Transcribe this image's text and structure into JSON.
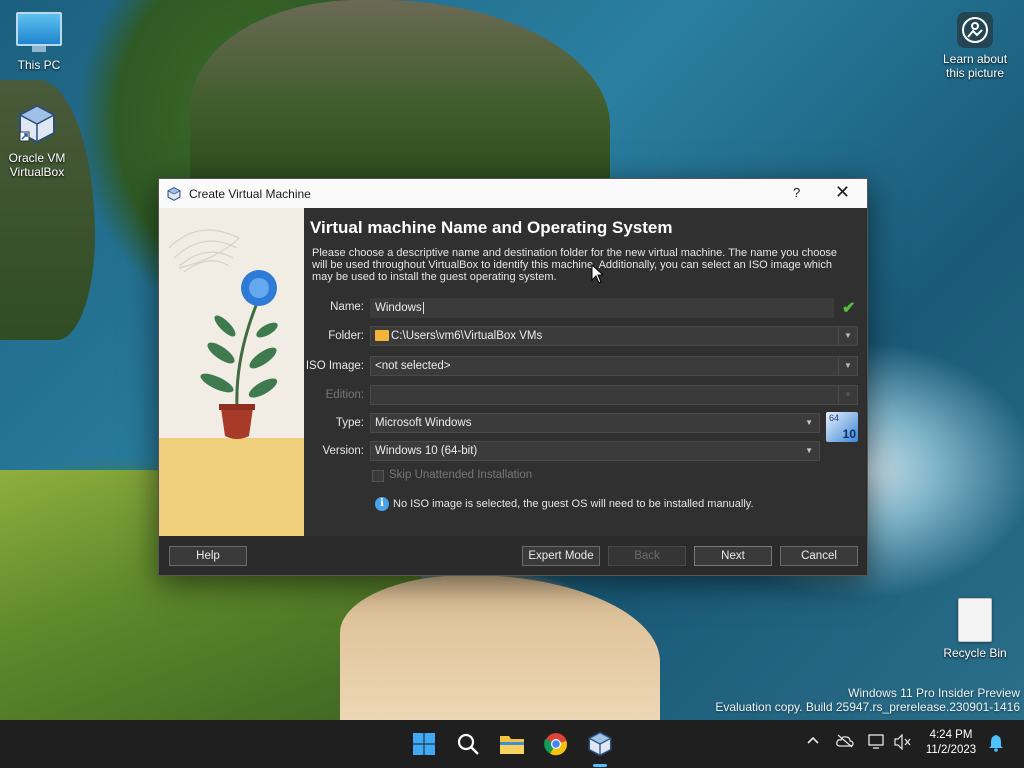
{
  "desktop": {
    "icons": [
      {
        "label": "This PC"
      },
      {
        "label": "Oracle VM VirtualBox"
      },
      {
        "label": "Learn about this picture"
      },
      {
        "label": "Recycle Bin"
      }
    ],
    "watermark_line1": "Windows 11 Pro Insider Preview",
    "watermark_line2": "Evaluation copy. Build 25947.rs_prerelease.230901-1416"
  },
  "dialog": {
    "title": "Create Virtual Machine",
    "help_glyph": "?",
    "close_glyph": "✕",
    "heading": "Virtual machine Name and Operating System",
    "description": "Please choose a descriptive name and destination folder for the new virtual machine. The name you choose will be used throughout VirtualBox to identify this machine. Additionally, you can select an ISO image which may be used to install the guest operating system.",
    "fields": {
      "name_label": "Name:",
      "name_value": "Windows",
      "folder_label": "Folder:",
      "folder_value": "C:\\Users\\vm6\\VirtualBox VMs",
      "iso_label": "ISO Image:",
      "iso_value": "<not selected>",
      "edition_label": "Edition:",
      "edition_value": "",
      "type_label": "Type:",
      "type_value": "Microsoft Windows",
      "version_label": "Version:",
      "version_value": "Windows 10 (64-bit)",
      "os_badge_top": "64",
      "os_badge_num": "10"
    },
    "skip_unattended_label": "Skip Unattended Installation",
    "skip_unattended_checked": false,
    "info_text": "No ISO image is selected, the guest OS will need to be installed manually.",
    "buttons": {
      "help": "Help",
      "expert_mode": "Expert Mode",
      "back": "Back",
      "next": "Next",
      "cancel": "Cancel"
    }
  },
  "taskbar": {
    "apps": [
      {
        "icon": "windows-start-icon"
      },
      {
        "icon": "search-icon"
      },
      {
        "icon": "file-explorer-icon"
      },
      {
        "icon": "chrome-icon"
      },
      {
        "icon": "virtualbox-icon",
        "active": true
      }
    ],
    "clock_time": "4:24 PM",
    "clock_date": "11/2/2023"
  },
  "colors": {
    "dialog_bg": "#303030",
    "accent_check": "#54c13a",
    "info_blue": "#4aa3e8",
    "taskbar_active": "#4cc2ff"
  }
}
